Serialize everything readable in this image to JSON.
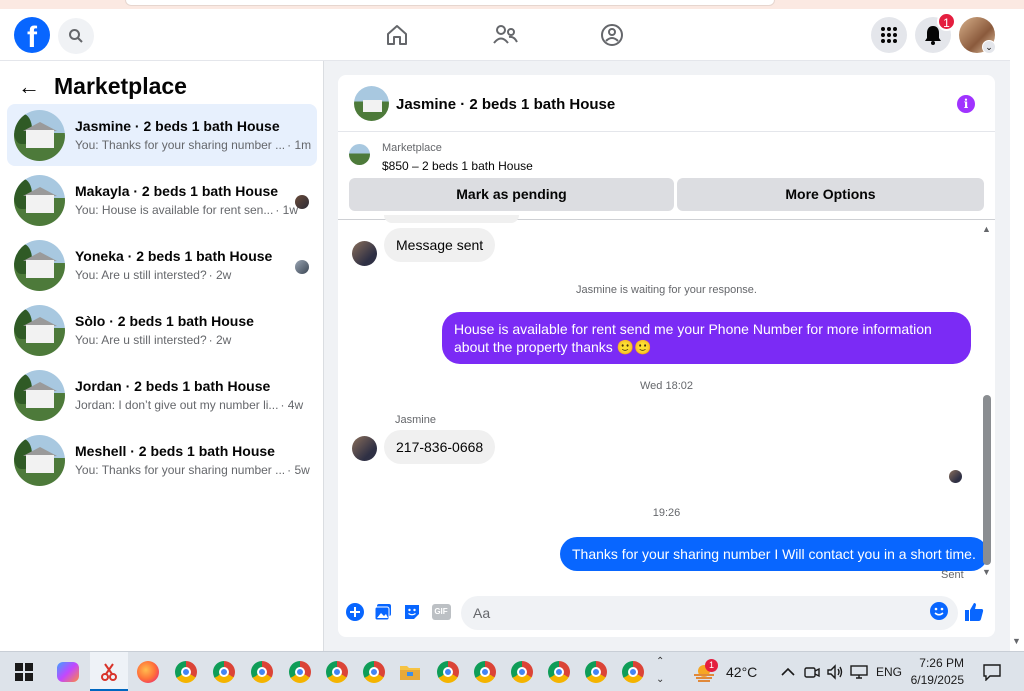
{
  "nav": {
    "logo_letter": "f",
    "notifications_count": "1"
  },
  "left": {
    "back_glyph": "←",
    "title": "Marketplace",
    "conversations": [
      {
        "title": "Jasmine · 2 beds 1 bath House",
        "preview": "You: Thanks for your sharing number ...",
        "time": "· 1m",
        "active": true
      },
      {
        "title": "Makayla · 2 beds 1 bath House",
        "preview": "You: House is available for rent sen...",
        "time": "· 1w"
      },
      {
        "title": "Yoneka · 2 beds 1 bath House",
        "preview": "You: Are u still intersted?",
        "time": "· 2w"
      },
      {
        "title": "Sòlo · 2 beds 1 bath House",
        "preview": "You: Are u still intersted?",
        "time": "· 2w"
      },
      {
        "title": "Jordan · 2 beds 1 bath House",
        "preview": "Jordan: I don’t give out my number li...",
        "time": "· 4w"
      },
      {
        "title": "Meshell · 2 beds 1 bath House",
        "preview": "You: Thanks for your sharing number ...",
        "time": "· 5w"
      }
    ]
  },
  "chat": {
    "title": "Jasmine · 2 beds 1 bath House",
    "info_glyph": "i",
    "listing_source": "Marketplace",
    "listing_price_title": "$850 – 2 beds 1 bath House",
    "mark_pending_label": "Mark as pending",
    "more_options_label": "More Options",
    "messages": {
      "message_sent": "Message sent",
      "waiting_note": "Jasmine is waiting for your response.",
      "outgoing_1": "House is available for rent send me your Phone Number for more information about the property thanks 🙂🙂",
      "timestamp_1": "Wed 18:02",
      "sender_name": "Jasmine",
      "incoming_number": "217-836-0668",
      "timestamp_2": "19:26",
      "outgoing_2": "Thanks for your sharing number I Will contact you in a short time.",
      "status": "Sent"
    },
    "composer_placeholder": "Aa",
    "gif_label": "GIF"
  },
  "taskbar": {
    "weather_badge": "1",
    "temperature": "42°C",
    "language": "ENG",
    "time": "7:26 PM",
    "date": "6/19/2025"
  },
  "colors": {
    "brand": "#0866ff",
    "outgoing_purple": "#7b2bf5",
    "active_row": "#e7f0fd"
  }
}
